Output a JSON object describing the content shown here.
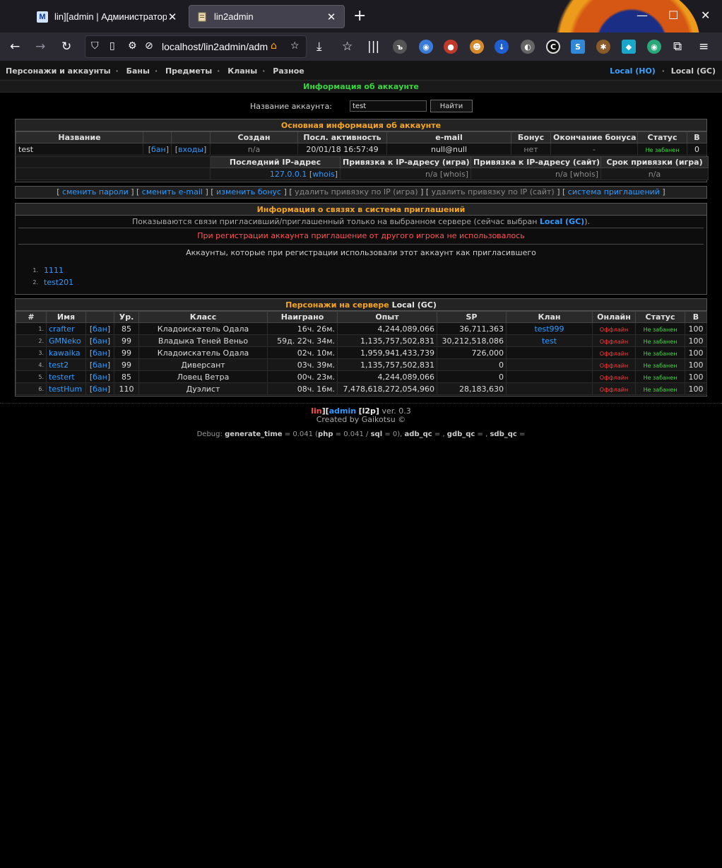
{
  "browser": {
    "tabs": [
      {
        "title": "lin][admin | Администраторы",
        "active": false,
        "favicon": "M"
      },
      {
        "title": "lin2admin",
        "active": true,
        "favicon": "page-icon"
      }
    ],
    "url": "localhost/lin2admin/adm"
  },
  "nav": {
    "left": [
      "Персонажи и аккаунты",
      "Баны",
      "Предметы",
      "Кланы",
      "Разное"
    ],
    "servers": [
      {
        "label": "Local (HO)",
        "current": true
      },
      {
        "label": "Local (GC)",
        "current": false
      }
    ]
  },
  "page_title": "Информация об аккаунте",
  "search": {
    "label": "Название аккаунта:",
    "value": "test",
    "button": "Найти"
  },
  "account": {
    "header": "Основная информация об аккаунте",
    "cols": [
      "Название",
      "Создан",
      "Посл. активность",
      "e-mail",
      "Бонус",
      "Окончание бонуса",
      "Статус",
      "В"
    ],
    "name": "test",
    "ban_link": "бан",
    "logins_link": "входы",
    "created": "n/a",
    "last_activity": "20/01/18 16:57:49",
    "email": "null@null",
    "bonus": "нет",
    "bonus_end": "-",
    "status": "Не забанен",
    "b": "0",
    "cols2": [
      "Последний IP-адрес",
      "Привязка к IP-адресу (игра)",
      "Привязка к IP-адресу (сайт)",
      "Срок привязки (игра)"
    ],
    "last_ip": "127.0.0.1",
    "whois": "whois",
    "bind_game": "n/a",
    "bind_site": "n/a",
    "bind_term": "n/a"
  },
  "actions": {
    "change_pass": "сменить пароли",
    "change_email": "сменить e-mail",
    "change_bonus": "изменить бонус",
    "unbind_game": "удалить привязку по IP (игра)",
    "unbind_site": "удалить привязку по IP (сайт)",
    "invite_system": "система приглашений"
  },
  "invites": {
    "header": "Информация о связях в система приглашений",
    "info_prefix": "Показываются связи пригласивший/приглашенный только на выбранном сервере (сейчас выбран",
    "info_server": "Local (GC)",
    "info_suffix": ").",
    "message": "При регистрации аккаунта приглашение от другого игрока не использовалось",
    "sub": "Аккаунты, которые при регистрации использовали этот аккаунт как пригласившего",
    "list": [
      "1111",
      "test201"
    ]
  },
  "chars": {
    "header_prefix": "Персонажи на сервере",
    "header_server": "Local (GC)",
    "cols": [
      "#",
      "Имя",
      "",
      "Ур.",
      "Класс",
      "Наиграно",
      "Опыт",
      "SP",
      "Клан",
      "Онлайн",
      "Статус",
      "В"
    ],
    "ban_label": "бан",
    "rows": [
      {
        "n": "1.",
        "name": "crafter",
        "lvl": "85",
        "cls": "Кладоискатель Одала",
        "played": "16ч. 26м.",
        "exp": "4,244,089,066",
        "sp": "36,711,363",
        "clan": "test999",
        "online": "Оффлайн",
        "status": "Не забанен",
        "b": "100"
      },
      {
        "n": "2.",
        "name": "GMNeko",
        "lvl": "99",
        "cls": "Владыка Теней Веньо",
        "played": "59д. 22ч. 34м.",
        "exp": "1,135,757,502,831",
        "sp": "30,212,518,086",
        "clan": "test",
        "online": "Оффлайн",
        "status": "Не забанен",
        "b": "100"
      },
      {
        "n": "3.",
        "name": "kawaika",
        "lvl": "99",
        "cls": "Кладоискатель Одала",
        "played": "02ч. 10м.",
        "exp": "1,959,941,433,739",
        "sp": "726,000",
        "clan": "",
        "online": "Оффлайн",
        "status": "Не забанен",
        "b": "100"
      },
      {
        "n": "4.",
        "name": "test2",
        "lvl": "99",
        "cls": "Диверсант",
        "played": "03ч. 39м.",
        "exp": "1,135,757,502,831",
        "sp": "0",
        "clan": "",
        "online": "Оффлайн",
        "status": "Не забанен",
        "b": "100"
      },
      {
        "n": "5.",
        "name": "testert",
        "lvl": "85",
        "cls": "Ловец Ветра",
        "played": "00ч. 23м.",
        "exp": "4,244,089,066",
        "sp": "0",
        "clan": "",
        "online": "Оффлайн",
        "status": "Не забанен",
        "b": "100"
      },
      {
        "n": "6.",
        "name": "testHum",
        "lvl": "110",
        "cls": "Дуэлист",
        "played": "08ч. 16м.",
        "exp": "7,478,618,272,054,960",
        "sp": "28,183,630",
        "clan": "",
        "online": "Оффлайн",
        "status": "Не забанен",
        "b": "100"
      }
    ]
  },
  "footer": {
    "brand1": "lin",
    "brand2": "admin",
    "brand3": "l2p",
    "version": "ver. 0.3",
    "created": "Created by Gaikotsu ©",
    "debug_label": "Debug:",
    "generate_time": "0.041",
    "php": "0.041",
    "sql": "0"
  }
}
